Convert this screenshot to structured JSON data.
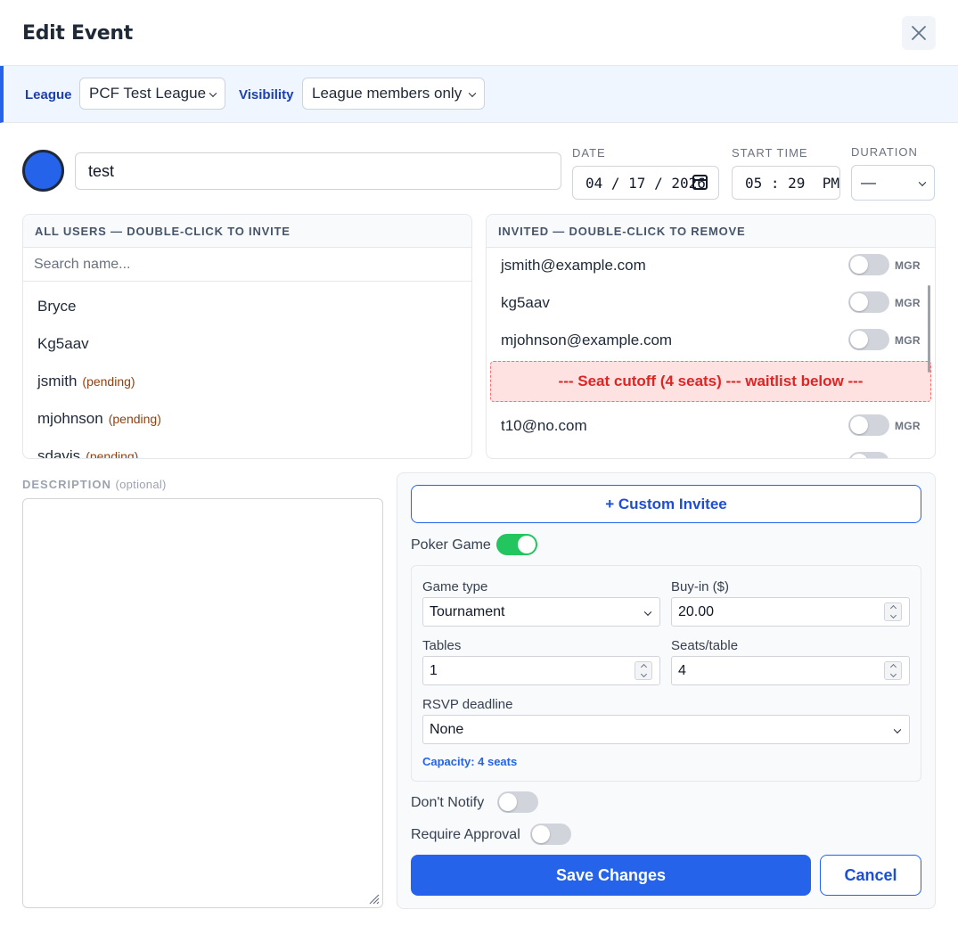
{
  "header": {
    "title": "Edit Event",
    "close_icon": "close-icon"
  },
  "league_bar": {
    "league_label": "League",
    "league_value": "PCF Test League",
    "visibility_label": "Visibility",
    "visibility_value": "League members only"
  },
  "event": {
    "color": "#2563eb",
    "name": "test",
    "date_label": "DATE",
    "date_value": "04 / 17 / 2026",
    "start_label": "START TIME",
    "start_value": "05 : 29  PM",
    "duration_label": "DURATION",
    "duration_value": "—"
  },
  "all_users": {
    "header": "ALL USERS — DOUBLE-CLICK TO INVITE",
    "search_placeholder": "Search name...",
    "items": [
      {
        "name": "Bryce",
        "status": ""
      },
      {
        "name": "Kg5aav",
        "status": ""
      },
      {
        "name": "jsmith",
        "status": "(pending)"
      },
      {
        "name": "mjohnson",
        "status": "(pending)"
      },
      {
        "name": "sdavis",
        "status": "(pending)"
      }
    ]
  },
  "invited": {
    "header": "INVITED — DOUBLE-CLICK TO REMOVE",
    "mgr_label": "MGR",
    "items": [
      {
        "email": "jsmith@example.com"
      },
      {
        "email": "kg5aav"
      },
      {
        "email": "mjohnson@example.com"
      },
      {
        "email": "t10@no.com"
      }
    ],
    "cutoff_text": "--- Seat cutoff (4 seats) --- waitlist below ---"
  },
  "description": {
    "label": "DESCRIPTION",
    "optional": "(optional)",
    "value": ""
  },
  "settings": {
    "custom_invitee": "+ Custom Invitee",
    "poker_game_label": "Poker Game",
    "game_type_label": "Game type",
    "game_type_value": "Tournament",
    "buyin_label": "Buy-in ($)",
    "buyin_value": "20.00",
    "tables_label": "Tables",
    "tables_value": "1",
    "seats_label": "Seats/table",
    "seats_value": "4",
    "rsvp_label": "RSVP deadline",
    "rsvp_value": "None",
    "capacity": "Capacity: 4 seats",
    "dont_notify_label": "Don't Notify",
    "require_approval_label": "Require Approval",
    "save_label": "Save Changes",
    "cancel_label": "Cancel"
  },
  "colors": {
    "accent": "#2563eb",
    "toggle_on": "#22c55e",
    "cutoff_bg": "#fee2e2",
    "cutoff_text": "#dc2626"
  }
}
